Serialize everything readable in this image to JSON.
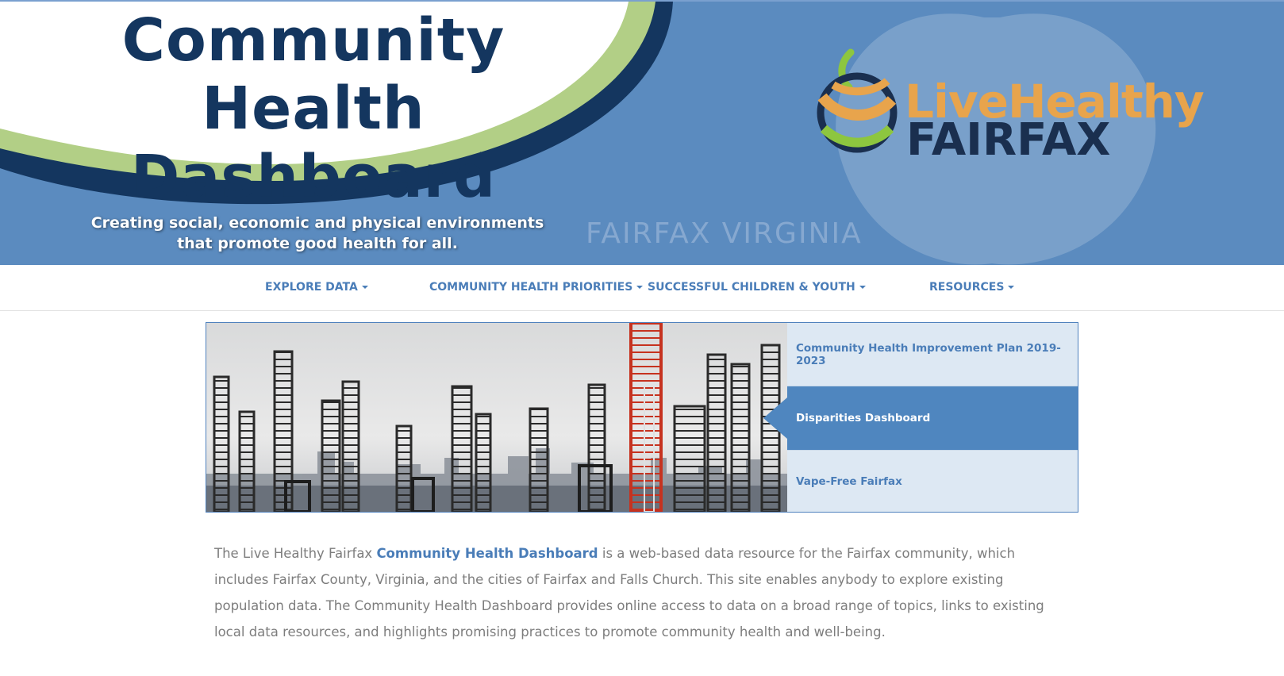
{
  "banner": {
    "title_line1": "Community Health",
    "title_line2": "Dashboard",
    "tagline_line1": "Creating social, economic and physical environments",
    "tagline_line2": "that promote good health for all.",
    "location": "FAIRFAX  VIRGINIA",
    "logo_line1": "LiveHealthy",
    "logo_line2": "FAIRFAX"
  },
  "nav": {
    "items": [
      {
        "label": "EXPLORE DATA"
      },
      {
        "label": "COMMUNITY HEALTH PRIORITIES"
      },
      {
        "label": "SUCCESSFUL CHILDREN & YOUTH"
      },
      {
        "label": "RESOURCES"
      }
    ]
  },
  "feature": {
    "links": [
      {
        "label": "Community Health Improvement Plan 2019-2023",
        "active": false
      },
      {
        "label": "Disparities Dashboard",
        "active": true
      },
      {
        "label": "Vape-Free Fairfax",
        "active": false
      }
    ]
  },
  "description": {
    "intro": "The Live Healthy Fairfax ",
    "link_text": "Community Health Dashboard",
    "body": " is a web-based data resource for the Fairfax community, which includes Fairfax County, Virginia, and the cities of Fairfax and Falls Church. This site enables anybody to explore existing population data. The Community Health Dashboard provides online access to data on a broad range of topics, links to existing local data resources, and highlights promising practices to promote community health and well-being."
  },
  "colors": {
    "banner_blue": "#5b8bbf",
    "navy": "#14365f",
    "accent_blue": "#4a7db8",
    "active_tab": "#4f86bf",
    "tab_light": "#dde8f3",
    "logo_orange": "#e8a44c",
    "swoosh_green": "#b2cf86"
  }
}
